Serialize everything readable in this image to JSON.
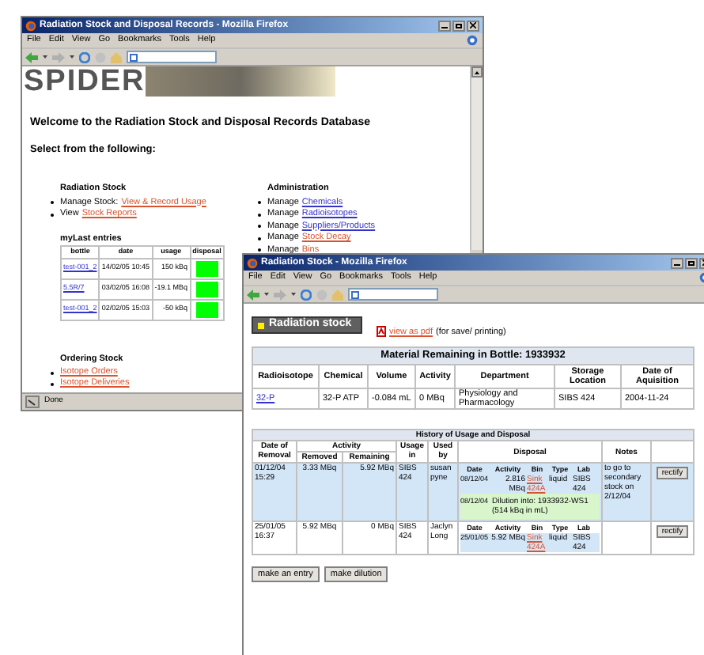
{
  "main_window": {
    "title": "Radiation Stock and Disposal Records - Mozilla Firefox",
    "menu": [
      "File",
      "Edit",
      "View",
      "Go",
      "Bookmarks",
      "Tools",
      "Help"
    ],
    "logo": "SPIDER",
    "welcome": "Welcome to the Radiation Stock and Disposal Records Database",
    "prompt": "Select from the following:",
    "radiation_stock": {
      "heading": "Radiation Stock",
      "items": [
        {
          "prefix": "Manage Stock:",
          "link": "View & Record Usage",
          "visited": true
        },
        {
          "prefix": "View",
          "link": "Stock Reports",
          "visited": true
        }
      ]
    },
    "my_last_entries": {
      "title": "myLast entries",
      "columns": [
        "bottle",
        "date",
        "usage",
        "disposal"
      ],
      "rows": [
        {
          "bottle": "test-001_2",
          "date": "14/02/05 10:45",
          "usage": "150 kBq",
          "color": "#00ff00"
        },
        {
          "bottle": "5.5R/7",
          "date": "03/02/05 16:08",
          "usage": "-19.1 MBq",
          "color": "#00ff00"
        },
        {
          "bottle": "test-001_2",
          "date": "02/02/05 15:03",
          "usage": "-50 kBq",
          "color": "#00ff00"
        }
      ]
    },
    "administration": {
      "heading": "Administration",
      "items": [
        {
          "prefix": "Manage",
          "link": "Chemicals",
          "visited": false
        },
        {
          "prefix": "Manage",
          "link": "Radioisotopes",
          "visited": false
        },
        {
          "prefix": "Manage",
          "link": "Suppliers/Products",
          "visited": false
        },
        {
          "prefix": "Manage",
          "link": "Stock Decay",
          "visited": true
        },
        {
          "prefix": "Manage",
          "link": "Bins",
          "visited": true
        }
      ]
    },
    "ordering_stock": {
      "heading": "Ordering Stock",
      "items": [
        {
          "link": "Isotope Orders",
          "visited": true
        },
        {
          "link": "Isotope Deliveries",
          "visited": true
        }
      ]
    },
    "status_bar": "Done"
  },
  "stock_window": {
    "title": "Radiation Stock - Mozilla Firefox",
    "menu": [
      "File",
      "Edit",
      "View",
      "Go",
      "Bookmarks",
      "Tools",
      "Help"
    ],
    "page_button": "Radiation stock",
    "pdf_link": "view as pdf",
    "pdf_note": "(for save/ printing)",
    "material": {
      "title": "Material Remaining in Bottle: 1933932",
      "columns": [
        "Radioisotope",
        "Chemical",
        "Volume",
        "Activity",
        "Department",
        "Storage Location",
        "Date of Aquisition"
      ],
      "row": [
        "32-P",
        "32-P ATP",
        "-0.084 mL",
        "0 MBq",
        "Physiology and Pharmacology",
        "SIBS 424",
        "2004-11-24"
      ]
    },
    "history": {
      "title": "History of Usage and Disposal",
      "headers": {
        "date": "Date of Removal",
        "activity": "Activity",
        "removed": "Removed",
        "remaining": "Remaining",
        "usage_in": "Usage in",
        "used_by": "Used by",
        "disposal": "Disposal",
        "notes": "Notes"
      },
      "rows": [
        {
          "highlighted": true,
          "disposal_columns": [
            "Date",
            "Activity",
            "Bin",
            "Type",
            "Lab"
          ],
          "date": "01/12/04 15:29",
          "removed": "3.33 MBq",
          "remaining": "5.92 MBq",
          "usage_in": "SIBS 424",
          "used_by": "susan pyne",
          "notes": "to go to secondary stock on 2/12/04",
          "button": "rectify",
          "disposals": [
            {
              "kind": "disposal",
              "date": "08/12/04",
              "activity": "2.816 MBq",
              "bin": "Sink 424A",
              "type": "liquid",
              "lab": "SIBS 424"
            },
            {
              "kind": "dilution",
              "date": "08/12/04",
              "text": "Dilution into: 1933932-WS1 (514 kBq in mL)"
            }
          ]
        },
        {
          "highlighted": false,
          "disposal_columns": [
            "Date",
            "Activity",
            "Bin",
            "Type",
            "Lab"
          ],
          "date": "25/01/05 16:37",
          "removed": "5.92 MBq",
          "remaining": "0 MBq",
          "usage_in": "SIBS 424",
          "used_by": "Jaclyn Long",
          "button": "rectify",
          "disposals": [
            {
              "kind": "disposal",
              "date": "25/01/05",
              "activity": "5.92 MBq",
              "bin": "Sink 424A",
              "type": "liquid",
              "lab": "SIBS 424"
            }
          ]
        }
      ]
    },
    "buttons": [
      "make an entry",
      "make dilution"
    ]
  }
}
